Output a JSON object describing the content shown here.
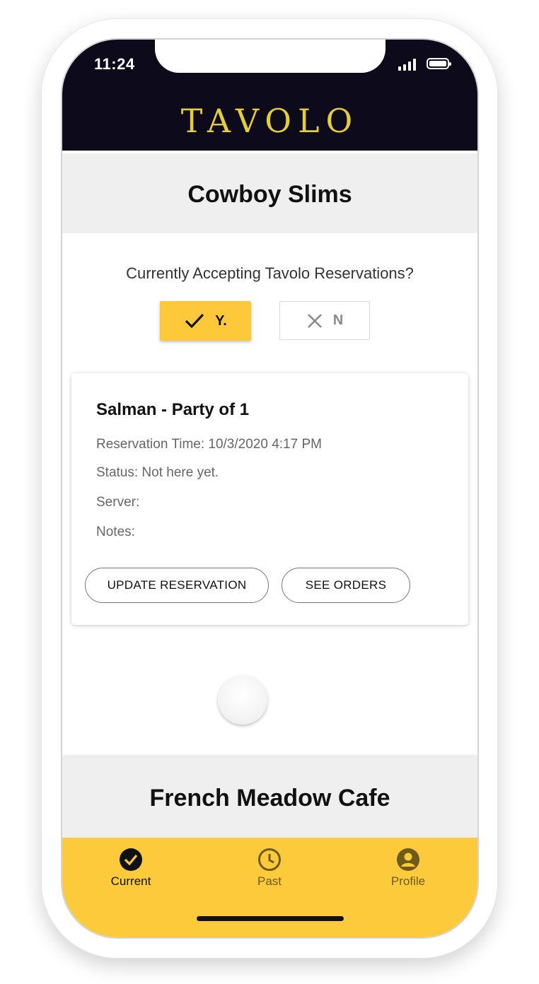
{
  "status_bar": {
    "time": "11:24"
  },
  "app": {
    "logo": "TAVOLO"
  },
  "restaurants": [
    {
      "name": "Cowboy Slims"
    },
    {
      "name": "French Meadow Cafe"
    }
  ],
  "accepting": {
    "question": "Currently Accepting Tavolo Reservations?",
    "yes_label": "Y.",
    "no_label": "N",
    "selected": "yes"
  },
  "reservation": {
    "title": "Salman - Party of 1",
    "time_line": "Reservation Time: 10/3/2020 4:17 PM",
    "status_line": "Status:  Not here yet.",
    "server_line": "Server:",
    "notes_line": "Notes:",
    "update_button": "UPDATE RESERVATION",
    "orders_button": "SEE ORDERS"
  },
  "bottom_nav": {
    "items": [
      {
        "label": "Current",
        "icon": "check-circle-icon",
        "active": true
      },
      {
        "label": "Past",
        "icon": "clock-icon",
        "active": false
      },
      {
        "label": "Profile",
        "icon": "account-circle-icon",
        "active": false
      }
    ]
  },
  "colors": {
    "header_bg": "#0d0a1c",
    "logo": "#e4cd3a",
    "accent": "#fdc93b",
    "band_bg": "#efefef"
  }
}
